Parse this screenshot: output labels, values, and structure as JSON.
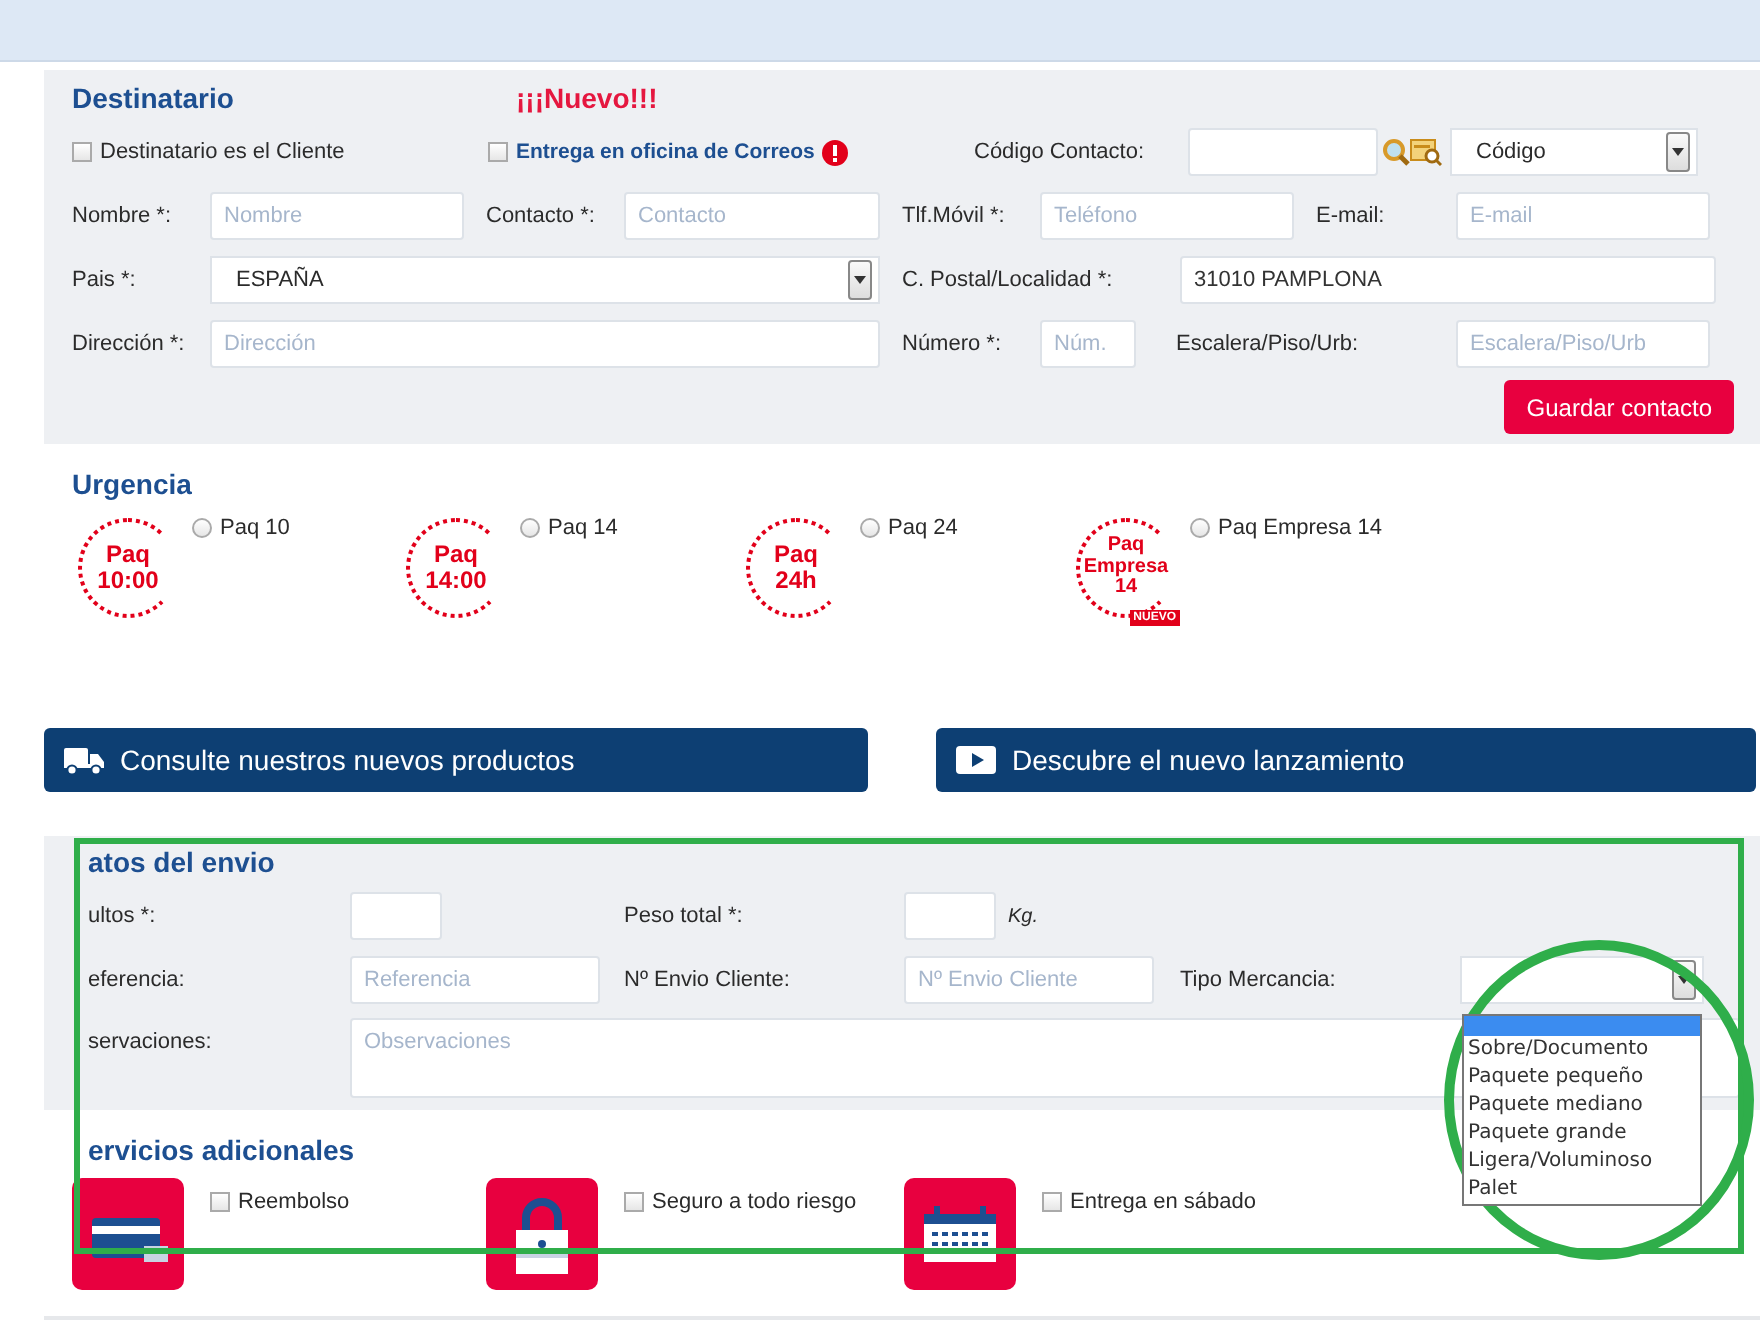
{
  "recipient": {
    "title": "Destinatario",
    "new_badge": "¡¡¡Nuevo!!!",
    "checkboxes": [
      {
        "label": "Destinatario es el Cliente",
        "checked": false
      },
      {
        "label": "Entrega en oficina de Correos",
        "checked": false
      }
    ],
    "contact_code": {
      "label": "Código Contacto:",
      "select_value": "Código"
    },
    "name": {
      "label": "Nombre *:",
      "placeholder": "Nombre"
    },
    "contact": {
      "label": "Contacto *:",
      "placeholder": "Contacto"
    },
    "mobile": {
      "label": "Tlf.Móvil *:",
      "placeholder": "Teléfono"
    },
    "email": {
      "label": "E-mail:",
      "placeholder": "E-mail"
    },
    "country": {
      "label": "Pais *:",
      "value": "ESPAÑA"
    },
    "postal": {
      "label": "C. Postal/Localidad *:",
      "value": "31010 PAMPLONA"
    },
    "address": {
      "label": "Dirección *:",
      "placeholder": "Dirección"
    },
    "number": {
      "label": "Número *:",
      "placeholder": "Núm."
    },
    "stair": {
      "label": "Escalera/Piso/Urb:",
      "placeholder": "Escalera/Piso/Urb"
    },
    "save_button": "Guardar contacto"
  },
  "urgency": {
    "title": "Urgencia",
    "options": [
      {
        "label": "Paq 10",
        "selected": false,
        "logo_lines": [
          "Paq",
          "10:00"
        ]
      },
      {
        "label": "Paq 14",
        "selected": false,
        "logo_lines": [
          "Paq",
          "14:00"
        ]
      },
      {
        "label": "Paq 24",
        "selected": false,
        "logo_lines": [
          "Paq",
          "24h"
        ]
      },
      {
        "label": "Paq Empresa 14",
        "selected": false,
        "logo_lines": [
          "Paq",
          "Empresa",
          "14"
        ],
        "logo_badge": "NUEVO"
      }
    ]
  },
  "promo_buttons": [
    {
      "kind": "truck",
      "label": "Consulte nuestros nuevos productos"
    },
    {
      "kind": "play",
      "label": "Descubre el nuevo lanzamiento"
    }
  ],
  "shipment": {
    "title": "atos del envio",
    "packages": {
      "label": "ultos *:"
    },
    "weight": {
      "label": "Peso total *:",
      "unit": "Kg."
    },
    "reference": {
      "label": "eferencia:",
      "placeholder": "Referencia"
    },
    "client_number": {
      "label": "Nº Envio Cliente:",
      "placeholder": "Nº Envio Cliente"
    },
    "merchandise_type": {
      "label": "Tipo Mercancia:",
      "blank_highlighted": true,
      "options": [
        "Sobre/Documento",
        "Paquete pequeño",
        "Paquete mediano",
        "Paquete grande",
        "Ligera/Voluminoso",
        "Palet"
      ]
    },
    "notes": {
      "label": "servaciones:",
      "placeholder": "Observaciones"
    }
  },
  "services": {
    "title": "ervicios adicionales",
    "items": [
      {
        "kind": "card",
        "label": "Reembolso",
        "checked": false
      },
      {
        "kind": "lock",
        "label": "Seguro a todo riesgo",
        "checked": false
      },
      {
        "kind": "calendar",
        "label": "Entrega en sábado",
        "checked": false
      }
    ]
  },
  "annotations": [
    {
      "kind": "rectangle",
      "color": "#2fae4a"
    },
    {
      "kind": "ellipse",
      "color": "#2fae4a"
    }
  ]
}
